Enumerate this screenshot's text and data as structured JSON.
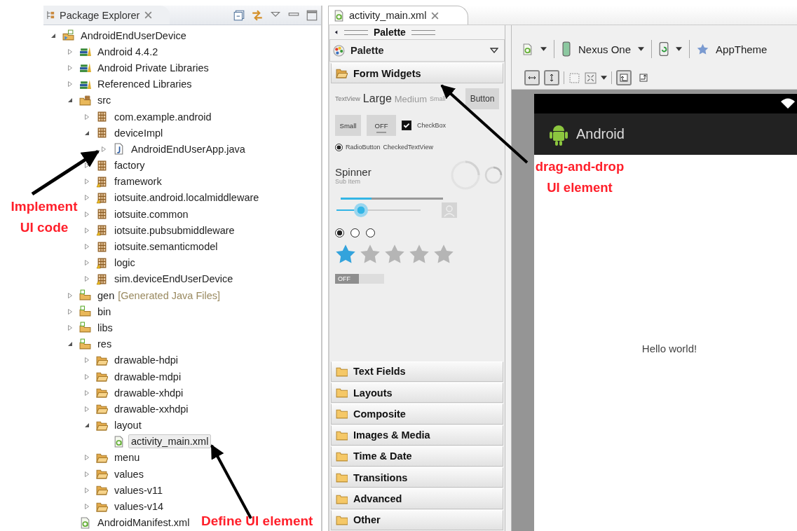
{
  "package_explorer": {
    "title": "Package Explorer",
    "tree": [
      {
        "label": "AndroidEndUserDevice",
        "kind": "project",
        "expanded": true,
        "selected": false,
        "children": [
          {
            "label": "Android 4.4.2",
            "kind": "library",
            "expanded": false,
            "selected": false
          },
          {
            "label": "Android Private Libraries",
            "kind": "library",
            "expanded": false,
            "selected": false
          },
          {
            "label": "Referenced Libraries",
            "kind": "library",
            "expanded": false,
            "selected": false
          },
          {
            "label": "src",
            "kind": "source-folder",
            "expanded": true,
            "selected": false,
            "children": [
              {
                "label": "com.example.android",
                "kind": "package",
                "expanded": false,
                "selected": false
              },
              {
                "label": "deviceImpl",
                "kind": "package",
                "expanded": true,
                "selected": false,
                "children": [
                  {
                    "label": "AndroidEndUserApp.java",
                    "kind": "java-file",
                    "expanded": false,
                    "selected": false
                  }
                ]
              },
              {
                "label": "factory",
                "kind": "package",
                "expanded": false,
                "selected": false
              },
              {
                "label": "framework",
                "kind": "package-warning",
                "expanded": false,
                "selected": false
              },
              {
                "label": "iotsuite.android.localmiddleware",
                "kind": "package-warning",
                "expanded": false,
                "selected": false
              },
              {
                "label": "iotsuite.common",
                "kind": "package",
                "expanded": false,
                "selected": false
              },
              {
                "label": "iotsuite.pubsubmiddleware",
                "kind": "package-warning",
                "expanded": false,
                "selected": false
              },
              {
                "label": "iotsuite.semanticmodel",
                "kind": "package",
                "expanded": false,
                "selected": false
              },
              {
                "label": "logic",
                "kind": "package-warning",
                "expanded": false,
                "selected": false
              },
              {
                "label": "sim.deviceEndUserDevice",
                "kind": "package-warning",
                "expanded": false,
                "selected": false
              }
            ]
          },
          {
            "label": "gen",
            "note": "[Generated Java Files]",
            "kind": "android-folder",
            "expanded": false,
            "selected": false
          },
          {
            "label": "bin",
            "kind": "android-folder",
            "expanded": false,
            "selected": false
          },
          {
            "label": "libs",
            "kind": "android-folder",
            "expanded": false,
            "selected": false
          },
          {
            "label": "res",
            "kind": "android-folder",
            "expanded": true,
            "selected": false,
            "children": [
              {
                "label": "drawable-hdpi",
                "kind": "folder",
                "expanded": false,
                "selected": false
              },
              {
                "label": "drawable-mdpi",
                "kind": "folder",
                "expanded": false,
                "selected": false
              },
              {
                "label": "drawable-xhdpi",
                "kind": "folder",
                "expanded": false,
                "selected": false
              },
              {
                "label": "drawable-xxhdpi",
                "kind": "folder",
                "expanded": false,
                "selected": false
              },
              {
                "label": "layout",
                "kind": "folder",
                "expanded": true,
                "selected": false,
                "children": [
                  {
                    "label": "activity_main.xml",
                    "kind": "xml-file",
                    "selected": true
                  }
                ]
              },
              {
                "label": "menu",
                "kind": "folder",
                "expanded": false,
                "selected": false
              },
              {
                "label": "values",
                "kind": "folder",
                "expanded": false,
                "selected": false
              },
              {
                "label": "values-v11",
                "kind": "folder",
                "expanded": false,
                "selected": false
              },
              {
                "label": "values-v14",
                "kind": "folder",
                "expanded": false,
                "selected": false
              }
            ]
          },
          {
            "label": "AndroidManifest.xml",
            "kind": "xml-file",
            "selected": false
          }
        ]
      }
    ]
  },
  "editor": {
    "tab": "activity_main.xml",
    "palette": {
      "header": "Palette",
      "title": "Palette",
      "categories": [
        {
          "label": "Form Widgets",
          "expanded": true
        },
        {
          "label": "Text Fields",
          "expanded": false
        },
        {
          "label": "Layouts",
          "expanded": false
        },
        {
          "label": "Composite",
          "expanded": false
        },
        {
          "label": "Images & Media",
          "expanded": false
        },
        {
          "label": "Time & Date",
          "expanded": false
        },
        {
          "label": "Transitions",
          "expanded": false
        },
        {
          "label": "Advanced",
          "expanded": false
        },
        {
          "label": "Other",
          "expanded": false
        }
      ],
      "form_widgets": {
        "text_views": [
          {
            "text": "TextView",
            "kind": "plain"
          },
          {
            "text": "Large",
            "kind": "large"
          },
          {
            "text": "Medium",
            "kind": "medium"
          },
          {
            "text": "Small",
            "kind": "small"
          }
        ],
        "button": "Button",
        "small_button": "Small",
        "toggle": {
          "label": "OFF",
          "on": false
        },
        "checkbox": {
          "label": "CheckBox",
          "checked": true
        },
        "radio_button": {
          "label": "RadioButton",
          "selected": true
        },
        "checked_text_view": "CheckedTextView",
        "spinner": {
          "label": "Spinner",
          "sub_item": "Sub Item"
        },
        "progress_bar": {
          "level": 0.3
        },
        "seek_bar": {
          "level": 0.29
        },
        "radio_group": [
          {
            "selected": true
          },
          {
            "selected": false
          },
          {
            "selected": false
          }
        ],
        "rating_bar": {
          "stars": 1
        },
        "switch": {
          "label": "OFF",
          "on": false
        }
      }
    },
    "toolbar": {
      "device": "Nexus One",
      "theme": "AppTheme",
      "layout_buttons": [
        {
          "kind": "fill-width",
          "pressed": true
        },
        {
          "kind": "fill-height",
          "pressed": true
        }
      ],
      "view_buttons": [
        {
          "kind": "first",
          "pressed": true
        },
        {
          "kind": "second",
          "pressed": false
        }
      ]
    },
    "preview": {
      "app_title": "Android",
      "content": "Hello world!"
    }
  },
  "annotations": [
    {
      "text": "Implement UI code"
    },
    {
      "text": "drag-and-drop UI element"
    },
    {
      "text": "Define UI element"
    }
  ]
}
